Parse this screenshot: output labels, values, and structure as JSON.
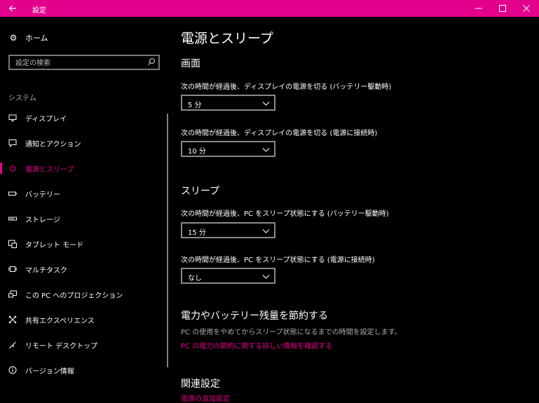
{
  "window": {
    "title": "設定",
    "accent": "#e3008c"
  },
  "sidebar": {
    "home_label": "ホーム",
    "search_placeholder": "設定の検索",
    "section_title": "システム",
    "items": [
      {
        "label": "ディスプレイ",
        "icon": "monitor-icon"
      },
      {
        "label": "通知とアクション",
        "icon": "chat-bubble-icon"
      },
      {
        "label": "電源とスリープ",
        "icon": "power-icon",
        "active": true
      },
      {
        "label": "バッテリー",
        "icon": "battery-icon"
      },
      {
        "label": "ストレージ",
        "icon": "storage-drive-icon"
      },
      {
        "label": "タブレット モード",
        "icon": "tablet-mode-icon"
      },
      {
        "label": "マルチタスク",
        "icon": "multitasking-icon"
      },
      {
        "label": "この PC へのプロジェクション",
        "icon": "projection-icon"
      },
      {
        "label": "共有エクスペリエンス",
        "icon": "shared-experiences-icon"
      },
      {
        "label": "リモート デスクトップ",
        "icon": "remote-desktop-icon"
      },
      {
        "label": "バージョン情報",
        "icon": "info-icon"
      }
    ]
  },
  "main": {
    "title": "電源とスリープ",
    "screen": {
      "heading": "画面",
      "battery_label": "次の時間が経過後、ディスプレイの電源を切る (バッテリー駆動時)",
      "battery_value": "5 分",
      "plugged_label": "次の時間が経過後、ディスプレイの電源を切る (電源に接続時)",
      "plugged_value": "10 分"
    },
    "sleep": {
      "heading": "スリープ",
      "battery_label": "次の時間が経過後、PC をスリープ状態にする (バッテリー駆動時)",
      "battery_value": "15 分",
      "plugged_label": "次の時間が経過後、PC をスリープ状態にする (電源に接続時)",
      "plugged_value": "なし"
    },
    "saving": {
      "heading": "電力やバッテリー残量を節約する",
      "description": "PC の使用をやめてからスリープ状態になるまでの時間を設定します。",
      "link": "PC の電力の節約に関する詳しい情報を確認する"
    },
    "related": {
      "heading": "関連設定",
      "link": "電源の追加設定"
    }
  }
}
